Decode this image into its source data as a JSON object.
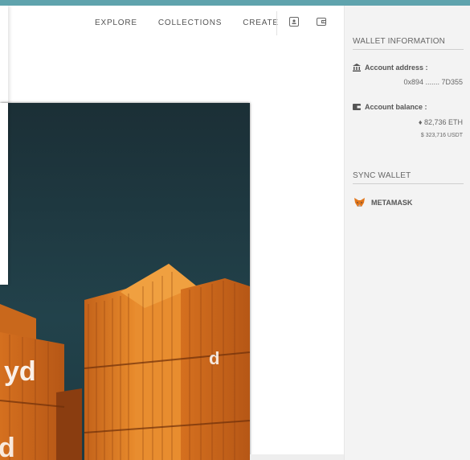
{
  "nav": {
    "items": [
      "EXPLORE",
      "COLLECTIONS",
      "CREATE"
    ],
    "icons": [
      "profile-icon",
      "wallet-icon"
    ]
  },
  "wallet": {
    "title": "WALLET INFORMATION",
    "address_label": "Account address :",
    "address_value": "0x894 ....... 7D355",
    "balance_label": "Account balance :",
    "eth_value": "82,736 ETH",
    "eth_symbol": "♦",
    "usdt_value": "323,716 USDT",
    "usdt_symbol": "$"
  },
  "sync": {
    "title": "SYNC WALLET",
    "provider": "METAMASK"
  },
  "colors": {
    "accent_bar": "#5fa3ad",
    "container_orange": "#e07a1f",
    "sky": "#1e3a44"
  }
}
